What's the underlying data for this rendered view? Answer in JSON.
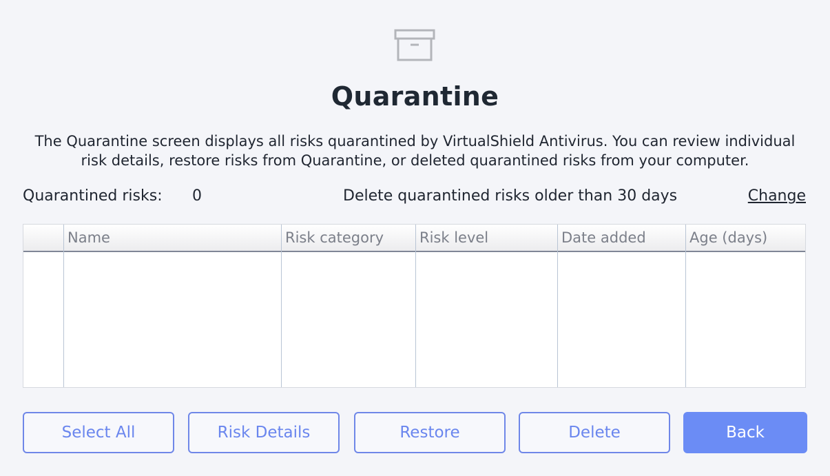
{
  "header": {
    "icon": "archive-box-icon",
    "title": "Quarantine",
    "description": "The Quarantine screen displays all risks quarantined by VirtualShield Antivirus. You can review individual risk details, restore risks from Quarantine, or deleted quarantined risks from your computer."
  },
  "stats": {
    "label": "Quarantined risks:",
    "count": "0",
    "policy": "Delete quarantined risks older than 30 days",
    "change_label": "Change"
  },
  "table": {
    "columns": [
      "",
      "Name",
      "Risk category",
      "Risk level",
      "Date added",
      "Age (days)"
    ],
    "rows": []
  },
  "buttons": {
    "select_all": "Select All",
    "risk_details": "Risk Details",
    "restore": "Restore",
    "delete": "Delete",
    "back": "Back"
  },
  "colors": {
    "accent": "#6b8cf5",
    "background": "#f4f5f9",
    "text": "#1f2530"
  }
}
